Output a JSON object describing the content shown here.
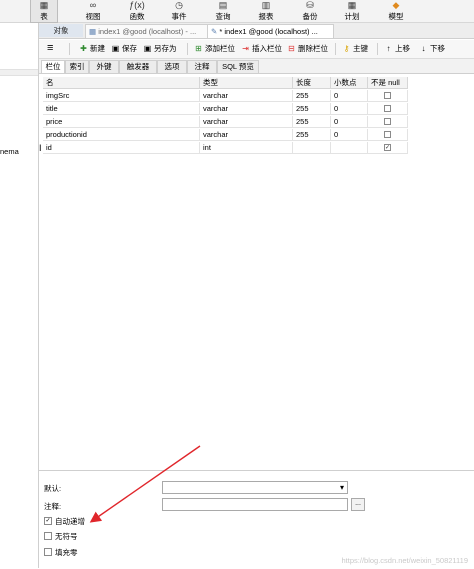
{
  "ribbon": {
    "items": [
      {
        "label": "表",
        "icon": "table-icon"
      },
      {
        "label": "视图",
        "icon": "view-icon"
      },
      {
        "label": "函数",
        "icon": "function-icon"
      },
      {
        "label": "事件",
        "icon": "event-icon"
      },
      {
        "label": "查询",
        "icon": "query-icon"
      },
      {
        "label": "报表",
        "icon": "report-icon"
      },
      {
        "label": "备份",
        "icon": "backup-icon"
      },
      {
        "label": "计划",
        "icon": "schedule-icon"
      },
      {
        "label": "模型",
        "icon": "model-icon"
      }
    ]
  },
  "sidebar": {
    "partial_text": "nema"
  },
  "tabs": {
    "object_label": "对象",
    "tab1": "index1 @good (localhost) - ...",
    "tab2": "* index1 @good (localhost) ..."
  },
  "toolbar": {
    "menu_glyph": "≡",
    "new": "新建",
    "save": "保存",
    "save_as": "另存为",
    "add_field": "添加栏位",
    "insert_field": "插入栏位",
    "delete_field": "删除栏位",
    "primary_key": "主键",
    "move_up": "上移",
    "move_down": "下移"
  },
  "subtabs": [
    "栏位",
    "索引",
    "外键",
    "触发器",
    "选项",
    "注释",
    "SQL 预览"
  ],
  "grid": {
    "headers": [
      "名",
      "类型",
      "长度",
      "小数点",
      "不是 null"
    ],
    "rows": [
      {
        "name": "imgSrc",
        "type": "varchar",
        "length": "255",
        "decimals": "0",
        "notnull": false
      },
      {
        "name": "title",
        "type": "varchar",
        "length": "255",
        "decimals": "0",
        "notnull": false
      },
      {
        "name": "price",
        "type": "varchar",
        "length": "255",
        "decimals": "0",
        "notnull": false
      },
      {
        "name": "productionid",
        "type": "varchar",
        "length": "255",
        "decimals": "0",
        "notnull": false
      },
      {
        "name": "id",
        "type": "int",
        "length": "",
        "decimals": "",
        "notnull": true
      }
    ]
  },
  "bottom": {
    "default_label": "默认:",
    "comment_label": "注释:",
    "ellipsis": "...",
    "dropdown_arrow": "▾",
    "auto_increment": {
      "label": "自动递增",
      "checked": true
    },
    "unsigned": {
      "label": "无符号",
      "checked": false
    },
    "zerofill": {
      "label": "填充零",
      "checked": false
    }
  },
  "watermark": "https://blog.csdn.net/weixin_50821119",
  "colors": {
    "annotation_arrow": "#e0262b"
  }
}
